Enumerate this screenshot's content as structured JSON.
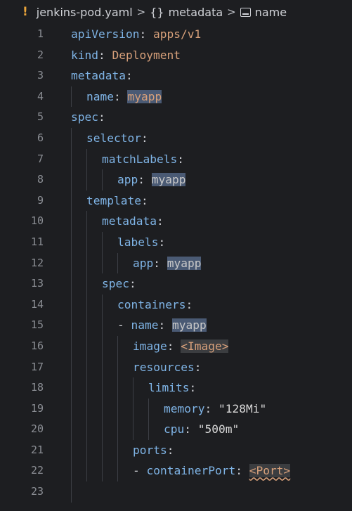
{
  "breadcrumb": {
    "file_icon": "!",
    "file": "jenkins-pod.yaml",
    "sep1": ">",
    "obj_icon": "{}",
    "node": "metadata",
    "sep2": ">",
    "leaf_icon": "symbol-string-icon",
    "leaf": "name"
  },
  "lines": [
    {
      "n": "1"
    },
    {
      "n": "2"
    },
    {
      "n": "3"
    },
    {
      "n": "4"
    },
    {
      "n": "5"
    },
    {
      "n": "6"
    },
    {
      "n": "7"
    },
    {
      "n": "8"
    },
    {
      "n": "9"
    },
    {
      "n": "10"
    },
    {
      "n": "11"
    },
    {
      "n": "12"
    },
    {
      "n": "13"
    },
    {
      "n": "14"
    },
    {
      "n": "15"
    },
    {
      "n": "16"
    },
    {
      "n": "17"
    },
    {
      "n": "18"
    },
    {
      "n": "19"
    },
    {
      "n": "20"
    },
    {
      "n": "21"
    },
    {
      "n": "22"
    },
    {
      "n": "23"
    }
  ],
  "code": {
    "l1_key": "apiVersion",
    "l1_val": "apps/v1",
    "l2_key": "kind",
    "l2_val": "Deployment",
    "l3_key": "metadata",
    "l4_key": "name",
    "l4_val": "myapp",
    "l5_key": "spec",
    "l6_key": "selector",
    "l7_key": "matchLabels",
    "l8_key": "app",
    "l8_val": "myapp",
    "l9_key": "template",
    "l10_key": "metadata",
    "l11_key": "labels",
    "l12_key": "app",
    "l12_val": "myapp",
    "l13_key": "spec",
    "l14_key": "containers",
    "l15_dash": "-",
    "l15_key": "name",
    "l15_val": "myapp",
    "l16_key": "image",
    "l16_val": "<Image>",
    "l17_key": "resources",
    "l18_key": "limits",
    "l19_key": "memory",
    "l19_val": "\"128Mi\"",
    "l20_key": "cpu",
    "l20_val": "\"500m\"",
    "l21_key": "ports",
    "l22_dash": "-",
    "l22_key": "containerPort",
    "l22_val": "<Port>",
    "colon": ":"
  }
}
